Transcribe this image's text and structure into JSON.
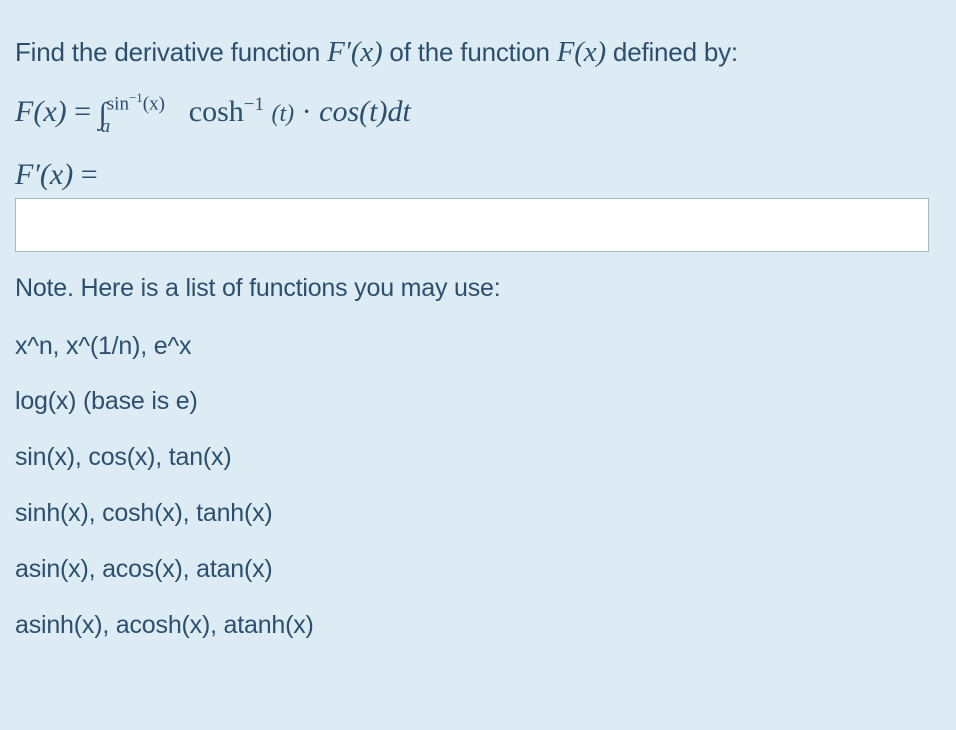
{
  "question": {
    "prefix": "Find the derivative function ",
    "derivative_symbol": "F′(x)",
    "middle": " of the function ",
    "function_symbol": "F(x)",
    "suffix": " defined by:"
  },
  "equation": {
    "lhs": "F(x)",
    "equals": "=",
    "integral_sign": "∫",
    "upper_limit_base": "sin",
    "upper_limit_exp": "−1",
    "upper_limit_arg": "(x)",
    "lower_limit": "a",
    "integrand_func": "cosh",
    "integrand_exp": "−1",
    "integrand_arg": "(t)",
    "dot": "·",
    "integrand_rest": "cos(t)dt"
  },
  "answer_label": {
    "lhs": "F′(x)",
    "equals": "="
  },
  "answer_input": {
    "value": "",
    "placeholder": ""
  },
  "note": "Note. Here is a list of functions you may use:",
  "function_list": [
    "x^n, x^(1/n), e^x",
    "log(x) (base is e)",
    "sin(x), cos(x), tan(x)",
    "sinh(x), cosh(x), tanh(x)",
    "asin(x), acos(x), atan(x)",
    "asinh(x), acosh(x), atanh(x)"
  ],
  "colors": {
    "background": "#dcebf4",
    "text": "#2d4f6e",
    "input_border": "#a9b7c3"
  }
}
